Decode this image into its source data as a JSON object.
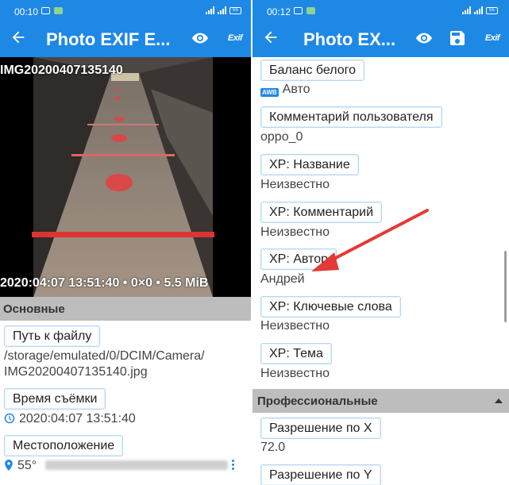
{
  "left": {
    "status": {
      "time": "00:10",
      "battery": "55"
    },
    "appbar": {
      "title": "Photo EXIF E..."
    },
    "photo": {
      "filename": "IMG20200407135140",
      "meta": "2020:04:07 13:51:40 • 0×0 • 5.5 MiB"
    },
    "section": "Основные",
    "fields": [
      {
        "label": "Путь к файлу",
        "value_lines": [
          "/storage/emulated/0/DCIM/Camera/",
          "IMG20200407135140.jpg"
        ]
      },
      {
        "label": "Время съёмки",
        "value": "2020:04:07 13:51:40"
      },
      {
        "label": "Местоположение",
        "value": "55°"
      }
    ]
  },
  "right": {
    "status": {
      "time": "00:12",
      "battery": "55"
    },
    "appbar": {
      "title": "Photo EX..."
    },
    "fields": [
      {
        "label": "Баланс белого",
        "value": "Авто",
        "icon": "AWB"
      },
      {
        "label": "Комментарий пользователя",
        "value": "oppo_0"
      },
      {
        "label": "XP: Название",
        "value": "Неизвестно"
      },
      {
        "label": "XP: Комментарий",
        "value": "Неизвестно"
      },
      {
        "label": "XP: Автор",
        "value": "Андрей"
      },
      {
        "label": "XP: Ключевые слова",
        "value": "Неизвестно"
      },
      {
        "label": "XP: Тема",
        "value": "Неизвестно"
      }
    ],
    "section": "Профессиональные",
    "pro_fields": [
      {
        "label": "Разрешение по X",
        "value": "72.0"
      },
      {
        "label": "Разрешение по Y"
      }
    ]
  },
  "colors": {
    "primary": "#1e88e5",
    "section_bg": "#bdbdbd",
    "arrow": "#e53935"
  }
}
